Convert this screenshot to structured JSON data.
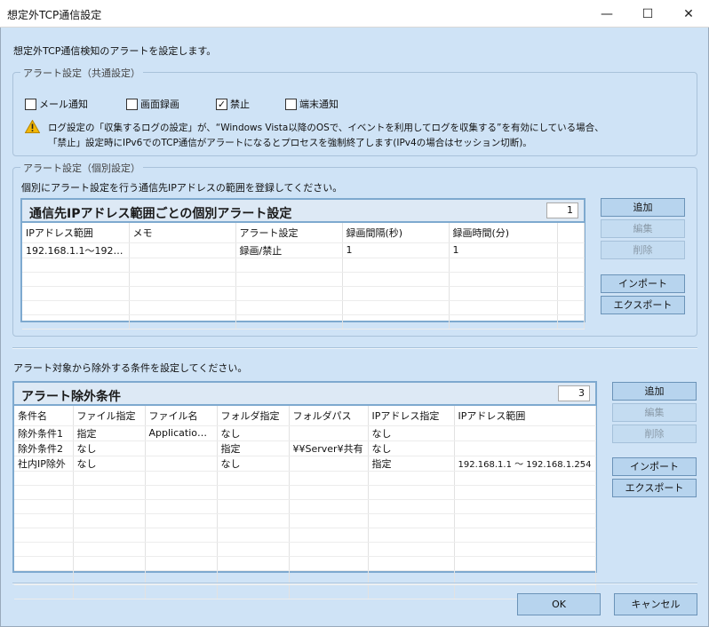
{
  "window": {
    "title": "想定外TCP通信設定",
    "minimize": "—",
    "maximize": "☐",
    "close": "✕"
  },
  "intro": "想定外TCP通信検知のアラートを設定します。",
  "common": {
    "legend": "アラート設定（共通設定）",
    "checkboxes": [
      {
        "label": "メール通知",
        "checked": false,
        "mark": ""
      },
      {
        "label": "画面録画",
        "checked": false,
        "mark": ""
      },
      {
        "label": "禁止",
        "checked": true,
        "mark": "✓"
      },
      {
        "label": "端末通知",
        "checked": false,
        "mark": ""
      }
    ],
    "warning_icon": "warning-icon",
    "warning_line1": "ログ設定の「収集するログの設定」が、“Windows Vista以降のOSで、イベントを利用してログを収集する”を有効にしている場合、",
    "warning_line2": "「禁止」設定時にIPv6でのTCP通信がアラートになるとプロセスを強制終了します(IPv4の場合はセッション切断)。"
  },
  "individual": {
    "legend": "アラート設定（個別設定）",
    "description": "個別にアラート設定を行う通信先IPアドレスの範囲を登録してください。",
    "panel_title": "通信先IPアドレス範囲ごとの個別アラート設定",
    "count": "1",
    "columns": [
      "IPアドレス範囲",
      "メモ",
      "アラート設定",
      "録画間隔(秒)",
      "録画時間(分)"
    ],
    "rows": [
      [
        "192.168.1.1～192.168…",
        "",
        "録画/禁止",
        "1",
        "1"
      ]
    ],
    "buttons": {
      "add": "追加",
      "edit": "編集",
      "delete": "削除",
      "import": "インポート",
      "export": "エクスポート"
    }
  },
  "exclude": {
    "description": "アラート対象から除外する条件を設定してください。",
    "panel_title": "アラート除外条件",
    "count": "3",
    "columns": [
      "条件名",
      "ファイル指定",
      "ファイル名",
      "フォルダ指定",
      "フォルダパス",
      "IPアドレス指定",
      "IPアドレス範囲"
    ],
    "rows": [
      [
        "除外条件1",
        "指定",
        "Application0…",
        "なし",
        "",
        "なし",
        ""
      ],
      [
        "除外条件2",
        "なし",
        "",
        "指定",
        "¥¥Server¥共有",
        "なし",
        ""
      ],
      [
        "社内IP除外",
        "なし",
        "",
        "なし",
        "",
        "指定",
        "192.168.1.1 ～ 192.168.1.254"
      ]
    ],
    "buttons": {
      "add": "追加",
      "edit": "編集",
      "delete": "削除",
      "import": "インポート",
      "export": "エクスポート"
    }
  },
  "footer": {
    "ok": "OK",
    "cancel": "キャンセル"
  }
}
